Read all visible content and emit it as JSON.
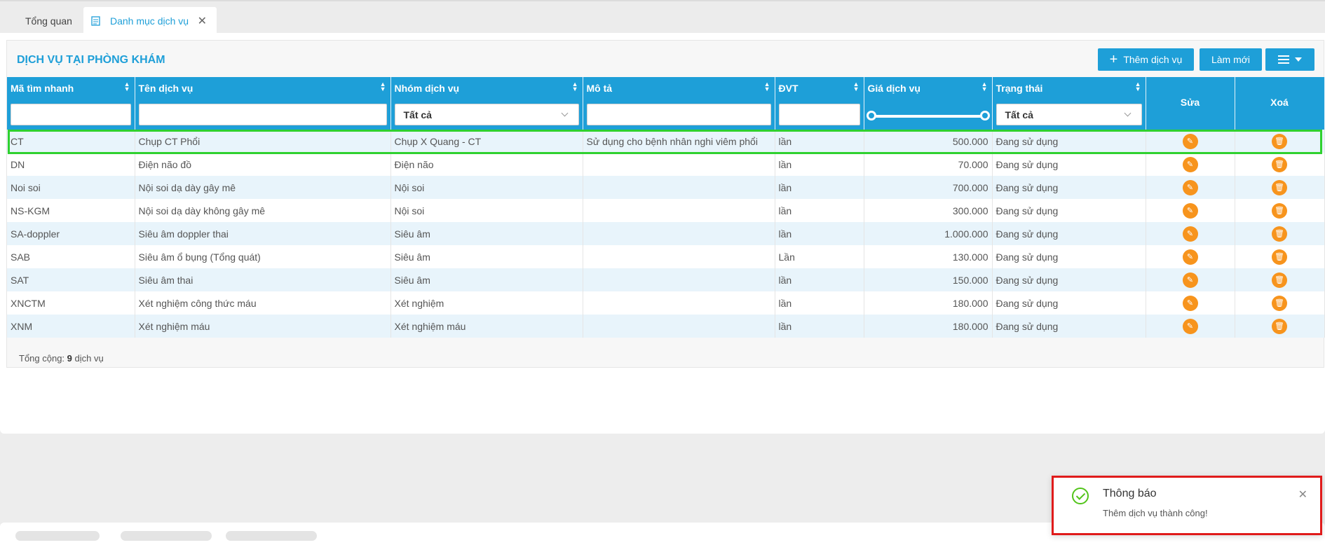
{
  "tabs": [
    {
      "label": "Tổng quan",
      "icon": "dashboard-icon"
    },
    {
      "label": "Danh mục dịch vụ",
      "icon": "catalog-icon",
      "active": true
    }
  ],
  "page": {
    "title": "DỊCH VỤ TẠI PHÒNG KHÁM",
    "add_button": "Thêm dịch vụ",
    "refresh_button": "Làm mới",
    "columns_button_icon": "columns-icon"
  },
  "table": {
    "columns": [
      "Mã tìm nhanh",
      "Tên dịch vụ",
      "Nhóm dịch vụ",
      "Mô tả",
      "ĐVT",
      "Giá dịch vụ",
      "Trạng thái",
      "Sửa",
      "Xoá"
    ],
    "filters": {
      "group_select": "Tất cả",
      "status_select": "Tất cả"
    },
    "rows": [
      {
        "code": "CT",
        "name": "Chụp CT Phổi",
        "group": "Chụp X Quang - CT",
        "desc": "Sử dụng cho bệnh nhân nghi viêm phổi",
        "unit": "lần",
        "price": "500.000",
        "status": "Đang sử dụng"
      },
      {
        "code": "DN",
        "name": "Điện não đồ",
        "group": "Điện não",
        "desc": "",
        "unit": "lần",
        "price": "70.000",
        "status": "Đang sử dụng"
      },
      {
        "code": "Noi soi",
        "name": "Nội soi dạ dày gây mê",
        "group": "Nội soi",
        "desc": "",
        "unit": "lần",
        "price": "700.000",
        "status": "Đang sử dụng"
      },
      {
        "code": "NS-KGM",
        "name": "Nội soi dạ dày không gây mê",
        "group": "Nội soi",
        "desc": "",
        "unit": "lần",
        "price": "300.000",
        "status": "Đang sử dụng"
      },
      {
        "code": "SA-doppler",
        "name": "Siêu âm doppler thai",
        "group": "Siêu âm",
        "desc": "",
        "unit": "lần",
        "price": "1.000.000",
        "status": "Đang sử dụng"
      },
      {
        "code": "SAB",
        "name": "Siêu âm ổ bụng (Tổng quát)",
        "group": "Siêu âm",
        "desc": "",
        "unit": "Lần",
        "price": "130.000",
        "status": "Đang sử dụng"
      },
      {
        "code": "SAT",
        "name": "Siêu âm thai",
        "group": "Siêu âm",
        "desc": "",
        "unit": "lần",
        "price": "150.000",
        "status": "Đang sử dụng"
      },
      {
        "code": "XNCTM",
        "name": "Xét nghiệm công thức máu",
        "group": "Xét nghiệm",
        "desc": "",
        "unit": "lần",
        "price": "180.000",
        "status": "Đang sử dụng"
      },
      {
        "code": "XNM",
        "name": "Xét nghiệm máu",
        "group": "Xét nghiệm máu",
        "desc": "",
        "unit": "lần",
        "price": "180.000",
        "status": "Đang sử dụng"
      }
    ]
  },
  "footer": {
    "total_prefix": "Tổng cộng:",
    "total_count": "9",
    "total_suffix": "dịch vụ"
  },
  "toast": {
    "title": "Thông báo",
    "message": "Thêm dịch vụ thành công!"
  },
  "colors": {
    "accent": "#1e9fd8",
    "action": "#f7941d",
    "row_alt": "#e8f4fb",
    "highlight_green": "#2fd12f",
    "highlight_red": "#e01b1b"
  }
}
